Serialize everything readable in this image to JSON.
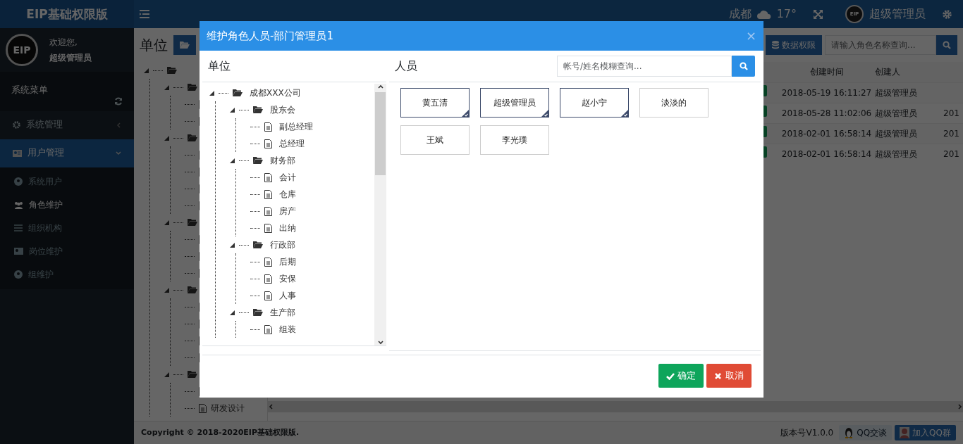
{
  "header": {
    "brand": "EIP基础权限版",
    "city": "成都",
    "temperature": "17°",
    "avatar_logo": "EIP",
    "user": "超级管理员"
  },
  "sidebar": {
    "logo": "EIP",
    "welcome": "欢迎您,",
    "user": "超级管理员",
    "menu_title": "系统菜单",
    "items": [
      {
        "label": "系统管理",
        "expanded": false
      },
      {
        "label": "用户管理",
        "expanded": true,
        "children": [
          {
            "label": "系统用户",
            "selected": false
          },
          {
            "label": "角色维护",
            "selected": true
          },
          {
            "label": "组织机构",
            "selected": false
          },
          {
            "label": "岗位维护",
            "selected": false
          },
          {
            "label": "组维护",
            "selected": false
          }
        ]
      }
    ]
  },
  "main": {
    "heading": "单位",
    "toolbar": {
      "button": "数据权限",
      "search_placeholder": "请输入角色名称查询..."
    },
    "tree": [
      {
        "kind": "folder",
        "children": [
          {
            "kind": "folder",
            "children": [
              {
                "kind": "file"
              },
              {
                "kind": "file"
              }
            ]
          },
          {
            "kind": "folder",
            "children": [
              {
                "kind": "file"
              },
              {
                "kind": "file"
              },
              {
                "kind": "file"
              },
              {
                "kind": "file"
              }
            ]
          },
          {
            "kind": "folder",
            "children": [
              {
                "kind": "file"
              },
              {
                "kind": "file"
              },
              {
                "kind": "file"
              }
            ]
          },
          {
            "kind": "folder",
            "children": [
              {
                "kind": "file"
              },
              {
                "kind": "file"
              },
              {
                "kind": "file"
              },
              {
                "kind": "file"
              }
            ]
          },
          {
            "kind": "folder",
            "children": [
              {
                "kind": "file"
              },
              {
                "kind": "file",
                "label": "研发设计"
              }
            ]
          }
        ]
      }
    ],
    "table": {
      "columns": [
        "创建时间",
        "创建人"
      ],
      "rows": [
        {
          "created": "2018-05-19 16:11:27",
          "creator": "超级管理员"
        },
        {
          "created": "2018-05-28 11:02:06",
          "creator": "超级管理员",
          "column_5": "201"
        },
        {
          "created": "2018-02-01 16:58:14",
          "creator": "超级管理员",
          "column_5": "201"
        },
        {
          "created": "2018-02-01 16:58:14",
          "creator": "超级管理员",
          "column_5": "201"
        }
      ]
    }
  },
  "footer": {
    "copyright": "Copyright © 2018-2020EIP基础权限版.",
    "version": "版本号V1.0.0",
    "buttons": [
      "QQ交谈",
      "加入QQ群"
    ]
  },
  "modal": {
    "title": "维护角色人员-部门管理员1",
    "close": "×",
    "left_heading": "单位",
    "right_heading": "人员",
    "search_placeholder": "帐号/姓名模糊查询...",
    "tree": [
      {
        "label": "成都XXX公司",
        "kind": "folder",
        "expanded": true,
        "children": [
          {
            "label": "股东会",
            "kind": "folder",
            "expanded": true,
            "children": [
              {
                "label": "副总经理",
                "kind": "file"
              },
              {
                "label": "总经理",
                "kind": "file"
              }
            ]
          },
          {
            "label": "财务部",
            "kind": "folder",
            "expanded": true,
            "children": [
              {
                "label": "会计",
                "kind": "file"
              },
              {
                "label": "仓库",
                "kind": "file"
              },
              {
                "label": "房产",
                "kind": "file"
              },
              {
                "label": "出纳",
                "kind": "file"
              }
            ]
          },
          {
            "label": "行政部",
            "kind": "folder",
            "expanded": true,
            "children": [
              {
                "label": "后期",
                "kind": "file"
              },
              {
                "label": "安保",
                "kind": "file"
              },
              {
                "label": "人事",
                "kind": "file"
              }
            ]
          },
          {
            "label": "生产部",
            "kind": "folder",
            "expanded": true,
            "children": [
              {
                "label": "组装",
                "kind": "file"
              }
            ]
          }
        ]
      }
    ],
    "people": [
      {
        "name": "黄五清",
        "selected": true
      },
      {
        "name": "超级管理员",
        "selected": true
      },
      {
        "name": "赵小宁",
        "selected": true
      },
      {
        "name": "淡淡的",
        "selected": false
      },
      {
        "name": "王斌",
        "selected": false
      },
      {
        "name": "李光璞",
        "selected": false
      }
    ],
    "buttons": [
      {
        "label": "确定",
        "kind": "confirm"
      },
      {
        "label": "取消",
        "kind": "cancel"
      }
    ]
  }
}
